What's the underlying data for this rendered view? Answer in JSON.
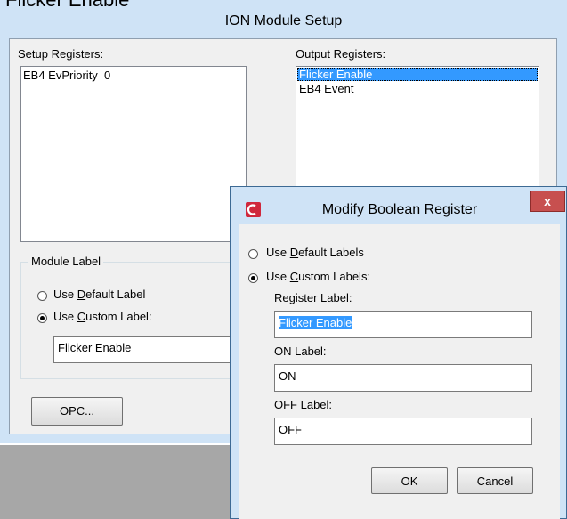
{
  "caption": "Flicker Enable",
  "main": {
    "title": "ION Module Setup",
    "setup_registers_label": "Setup Registers:",
    "setup_registers": [
      "EB4 EvPriority  0"
    ],
    "output_registers_label": "Output Registers:",
    "output_registers": [
      "Flicker Enable",
      "EB4 Event"
    ],
    "module_label_group": "Module Label",
    "use_default_label": {
      "prefix": "Use ",
      "key": "D",
      "rest": "efault Label"
    },
    "use_custom_label": {
      "prefix": "Use ",
      "key": "C",
      "rest": "ustom Label:"
    },
    "custom_label_value": "Flicker Enable",
    "opc_button": "OPC..."
  },
  "dialog": {
    "title": "Modify Boolean Register",
    "close": "x",
    "use_default_labels": {
      "prefix": "Use ",
      "key": "D",
      "rest": "efault Labels"
    },
    "use_custom_labels": {
      "prefix": "Use ",
      "key": "C",
      "rest": "ustom Labels:"
    },
    "register_label": "Register Label:",
    "register_value": "Flicker Enable",
    "on_label": "ON Label:",
    "on_value": "ON",
    "off_label": "OFF Label:",
    "off_value": "OFF",
    "ok_button": "OK",
    "cancel_button": "Cancel"
  },
  "colors": {
    "selection": "#3399ff",
    "title_bar": "#cfe3f6",
    "close_button": "#c7504f",
    "app_icon": "#d0283c"
  }
}
